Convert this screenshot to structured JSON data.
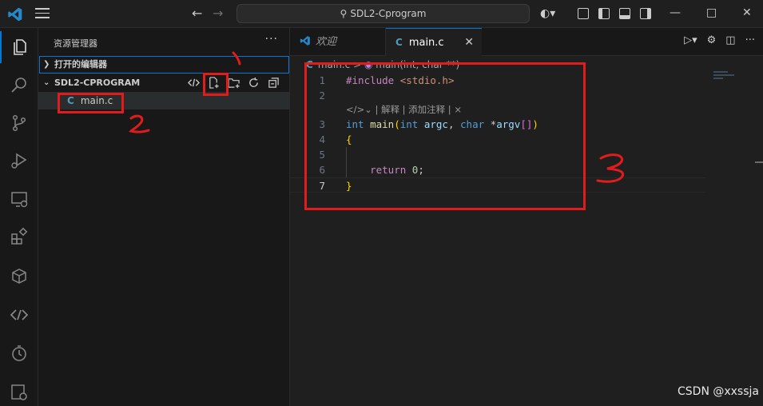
{
  "titlebar": {
    "search_text": "SDL2-Cprogram",
    "back_icon": "arrow-left-icon",
    "forward_icon": "arrow-right-icon",
    "window_controls": [
      "minimize",
      "maximize",
      "close"
    ]
  },
  "sidebar": {
    "title": "资源管理器",
    "more": "···",
    "open_editors": "打开的编辑器",
    "project": "SDL2-CPROGRAM",
    "files": [
      {
        "icon": "C",
        "name": "main.c"
      }
    ]
  },
  "tabs": [
    {
      "label": "欢迎",
      "active": false
    },
    {
      "label": "main.c",
      "active": true
    }
  ],
  "breadcrumb": {
    "file": "main.c",
    "sep": ">",
    "symbol": "main(int, char **)"
  },
  "code": {
    "lens": "| 解释 | 添加注释 | ×",
    "line_numbers": [
      "1",
      "2",
      "3",
      "4",
      "5",
      "6",
      "7"
    ]
  },
  "annotations": {
    "label_1": "1",
    "label_2": "2",
    "label_3": "3"
  },
  "watermark": "CSDN @xxssja",
  "colors": {
    "accent": "#0078d4",
    "annotation": "#e01c1c",
    "c_icon": "#519aba"
  }
}
